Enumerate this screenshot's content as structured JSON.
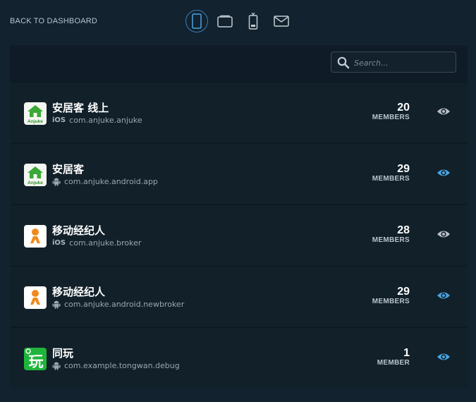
{
  "nav": {
    "back_label": "BACK TO DASHBOARD"
  },
  "device_tabs": [
    {
      "icon": "phone-icon",
      "active": true
    },
    {
      "icon": "tablet-icon",
      "active": false
    },
    {
      "icon": "device-remote-icon",
      "active": false
    },
    {
      "icon": "mail-icon",
      "active": false
    }
  ],
  "search": {
    "placeholder": "Search...",
    "value": ""
  },
  "apps": [
    {
      "name": "安居客 线上",
      "platform": "iOS",
      "bundle_id": "com.anjuke.anjuke",
      "members": "20",
      "members_label": "MEMBERS",
      "icon": "anjuke-house-icon",
      "icon_caption": "Anjuke",
      "watched": false
    },
    {
      "name": "安居客",
      "platform": "android",
      "bundle_id": "com.anjuke.android.app",
      "members": "29",
      "members_label": "MEMBERS",
      "icon": "anjuke-house-icon",
      "icon_caption": "Anjuke",
      "watched": true
    },
    {
      "name": "移动经纪人",
      "platform": "iOS",
      "bundle_id": "com.anjuke.broker",
      "members": "28",
      "members_label": "MEMBERS",
      "icon": "broker-person-icon",
      "watched": false
    },
    {
      "name": "移动经纪人",
      "platform": "android",
      "bundle_id": "com.anjuke.android.newbroker",
      "members": "29",
      "members_label": "MEMBERS",
      "icon": "broker-person-icon",
      "watched": true
    },
    {
      "name": "同玩",
      "platform": "android",
      "bundle_id": "com.example.tongwan.debug",
      "members": "1",
      "members_label": "MEMBER",
      "icon": "tongwan-icon",
      "icon_glyph": "玩",
      "watched": true
    }
  ],
  "colors": {
    "background": "#12222f",
    "panel": "#0f1c27",
    "row": "#112029",
    "accent_blue": "#4aa3df",
    "icon_gray": "#b8c0c8",
    "anjuke_green": "#3aa935",
    "broker_orange": "#f08a1c",
    "tongwan_green": "#1fb53a"
  }
}
